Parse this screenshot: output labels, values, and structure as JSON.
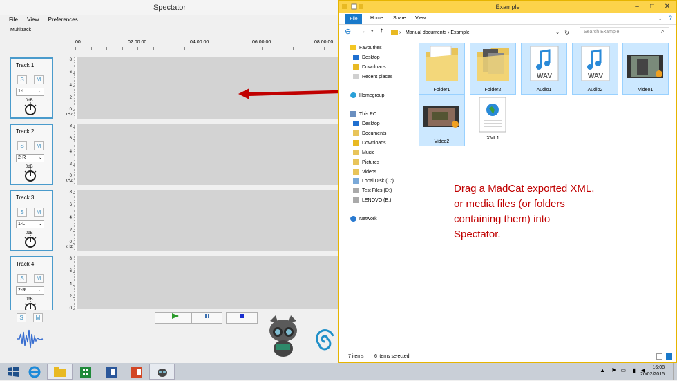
{
  "spectator": {
    "title": "Spectator",
    "menu": [
      "File",
      "View",
      "Preferences"
    ],
    "multitrack_label": "Multitrack",
    "ruler": [
      "00",
      "02:00:00",
      "04:00:00",
      "06:00:00",
      "08:00:00"
    ],
    "scale_labels": [
      "8",
      "6",
      "4",
      "2",
      "0",
      "kHz"
    ],
    "tracks": [
      {
        "name": "Track 1",
        "s": "S",
        "m": "M",
        "channel": "1-L",
        "db": "0dB"
      },
      {
        "name": "Track 2",
        "s": "S",
        "m": "M",
        "channel": "2-R",
        "db": "0dB"
      },
      {
        "name": "Track 3",
        "s": "S",
        "m": "M",
        "channel": "1-L",
        "db": "0dB"
      },
      {
        "name": "Track 4",
        "s": "S",
        "m": "M",
        "channel": "2-R",
        "db": "0dB"
      }
    ],
    "bottom": {
      "s": "S",
      "m": "M",
      "play_icon": "play-icon",
      "pause_icon": "pause-icon",
      "stop_icon": "stop-icon"
    }
  },
  "explorer": {
    "title": "Example",
    "tabs": {
      "file": "File",
      "home": "Home",
      "share": "Share",
      "view": "View"
    },
    "address": {
      "part1": "Manual documents",
      "sep": "›",
      "part2": "Example"
    },
    "search_placeholder": "Search Example",
    "nav": {
      "favourites": "Favourites",
      "desktop": "Desktop",
      "downloads": "Downloads",
      "recent": "Recent places",
      "homegroup": "Homegroup",
      "thispc": "This PC",
      "pc_desktop": "Desktop",
      "documents": "Documents",
      "pc_downloads": "Downloads",
      "music": "Music",
      "pictures": "Pictures",
      "videos": "Videos",
      "localdisk": "Local Disk (C:)",
      "testfiles": "Test Files (D:)",
      "lenovo": "LENOVO (E:)",
      "network": "Network"
    },
    "files": [
      "Folder1",
      "Folder2",
      "Audio1",
      "Audio2",
      "Video1",
      "Video2",
      "XML1"
    ],
    "wav_text": "WAV",
    "hint": "Drag a MadCat exported XML, or media files (or folders containing them) into Spectator.",
    "status": {
      "count": "7 items",
      "selected": "6 items selected"
    }
  },
  "taskbar": {
    "time": "16:08",
    "date": "20/02/2015"
  },
  "colors": {
    "track_border": "#4a9bcc",
    "arrow": "#c00000",
    "selection": "#cce8ff",
    "explorer_title": "#fcd34a"
  }
}
